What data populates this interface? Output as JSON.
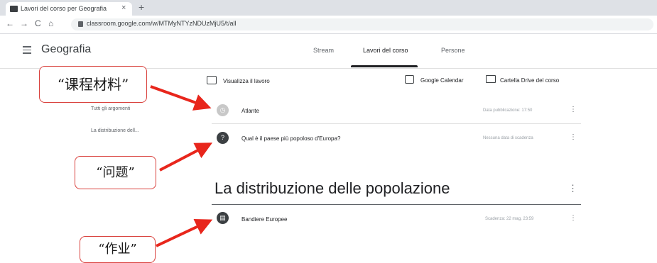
{
  "browser": {
    "tab_title": "Lavori del corso per Geografia",
    "tab_close": "×",
    "new_tab": "+",
    "nav": {
      "back": "←",
      "forward": "→",
      "reload": "C",
      "home": "⌂"
    },
    "url": "classroom.google.com/w/MTMyNTYzNDUzMjU5/t/all"
  },
  "header": {
    "class_title": "Geografia",
    "tabs": [
      "Stream",
      "Lavori del corso",
      "Persone"
    ],
    "active_tab": "Lavori del corso"
  },
  "toolbar": {
    "view_work_label": "Visualizza il lavoro",
    "calendar_label": "Google Calendar",
    "drive_label": "Cartella Drive del corso"
  },
  "sidebar": {
    "items": [
      "Tutti gli argomenti",
      "La distribuzione dell..."
    ]
  },
  "items": [
    {
      "title": "Atlante",
      "meta": "Data pubblicazione: 17:50",
      "icon": "material-icon"
    },
    {
      "title": "Qual è il paese più popoloso d'Europa?",
      "meta": "Nessuna data di scadenza",
      "icon": "question-icon"
    }
  ],
  "topic": {
    "title": "La distribuzione delle popolazione",
    "items": [
      {
        "title": "Bandiere Europee",
        "meta": "Scadenza: 22 mag, 23:59",
        "icon": "assignment-icon"
      }
    ]
  },
  "kebab_glyph": "⋮",
  "annotations": {
    "callout_1": "“课程材料”",
    "callout_2": "“问题”",
    "callout_3": "“作业”"
  },
  "colors": {
    "accent": "#202124",
    "callout_border": "#d9413d",
    "arrow": "#e8261c"
  }
}
